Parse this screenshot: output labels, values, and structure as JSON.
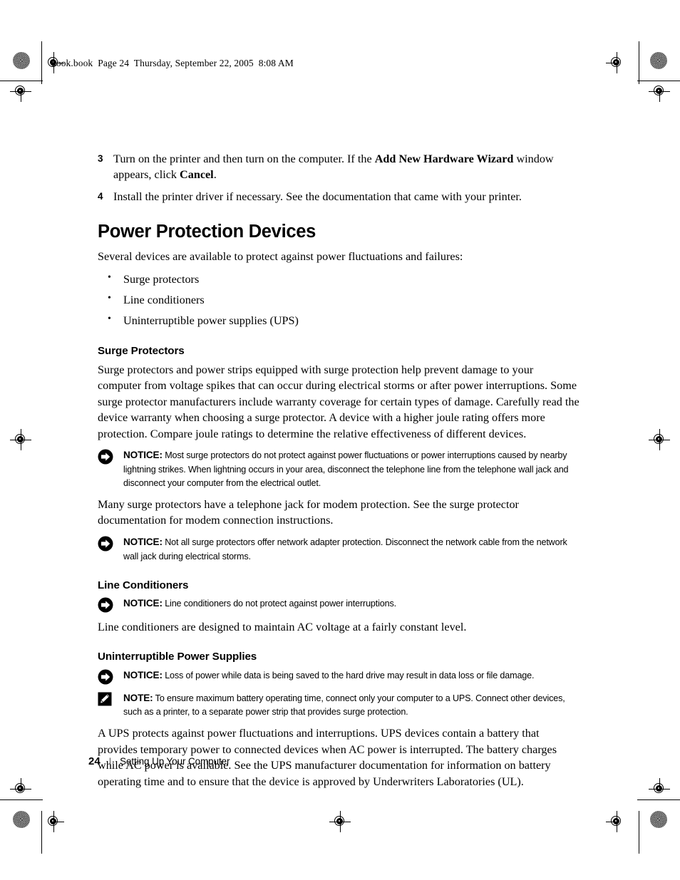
{
  "page": {
    "file_header": "book.book  Page 24  Thursday, September 22, 2005  8:08 AM"
  },
  "content": {
    "steps": [
      {
        "num": "3",
        "parts": [
          {
            "t": "Turn on the printer and then turn on the computer. If the ",
            "b": false
          },
          {
            "t": "Add New Hardware Wizard",
            "b": true
          },
          {
            "t": " window appears, click ",
            "b": false
          },
          {
            "t": "Cancel",
            "b": true
          },
          {
            "t": ".",
            "b": false
          }
        ]
      },
      {
        "num": "4",
        "parts": [
          {
            "t": "Install the printer driver if necessary. See the documentation that came with your printer.",
            "b": false
          }
        ]
      }
    ],
    "h1": "Power Protection Devices",
    "intro": "Several devices are available to protect against power fluctuations and failures:",
    "bullets": [
      "Surge protectors",
      "Line conditioners",
      "Uninterruptible power supplies (UPS)"
    ],
    "surge": {
      "heading": "Surge Protectors",
      "para1": "Surge protectors and power strips equipped with surge protection help prevent damage to your computer from voltage spikes that can occur during electrical storms or after power interruptions. Some surge protector manufacturers include warranty coverage for certain types of damage. Carefully read the device warranty when choosing a surge protector. A device with a higher joule rating offers more protection. Compare joule ratings to determine the relative effectiveness of different devices.",
      "notice1": {
        "icon": "notice-arrow-icon",
        "lead": "NOTICE:",
        "text": " Most surge protectors do not protect against power fluctuations or power interruptions caused by nearby lightning strikes. When lightning occurs in your area, disconnect the telephone line from the telephone wall jack and disconnect your computer from the electrical outlet."
      },
      "para2": "Many surge protectors have a telephone jack for modem protection. See the surge protector documentation for modem connection instructions.",
      "notice2": {
        "icon": "notice-arrow-icon",
        "lead": "NOTICE:",
        "text": " Not all surge protectors offer network adapter protection. Disconnect the network cable from the network wall jack during electrical storms."
      }
    },
    "line_conditioners": {
      "heading": "Line Conditioners",
      "notice": {
        "icon": "notice-arrow-icon",
        "lead": "NOTICE:",
        "text": " Line conditioners do not protect against power interruptions."
      },
      "para": "Line conditioners are designed to maintain AC voltage at a fairly constant level."
    },
    "ups": {
      "heading": "Uninterruptible Power Supplies",
      "notice": {
        "icon": "notice-arrow-icon",
        "lead": "NOTICE:",
        "text": " Loss of power while data is being saved to the hard drive may result in data loss or file damage."
      },
      "note": {
        "icon": "note-pencil-icon",
        "lead": "NOTE:",
        "text": " To ensure maximum battery operating time, connect only your computer to a UPS. Connect other devices, such as a printer, to a separate power strip that provides surge protection."
      },
      "para": "A UPS protects against power fluctuations and interruptions. UPS devices contain a battery that provides temporary power to connected devices when AC power is interrupted. The battery charges while AC power is available. See the UPS manufacturer documentation for information on battery operating time and to ensure that the device is approved by Underwriters Laboratories (UL)."
    }
  },
  "footer": {
    "page_number": "24",
    "separator": "|",
    "section_title": "Setting Up Your Computer"
  }
}
